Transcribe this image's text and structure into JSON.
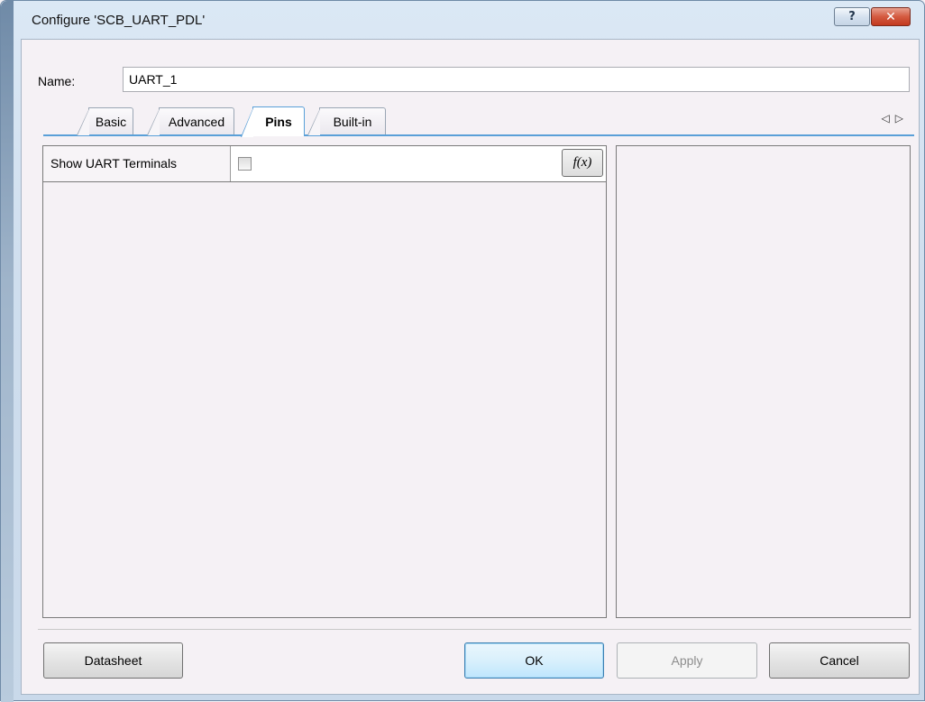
{
  "window": {
    "title": "Configure 'SCB_UART_PDL'",
    "help_icon": "?",
    "close_icon": "✕"
  },
  "name_field": {
    "label": "Name:",
    "value": "UART_1"
  },
  "tabs": [
    {
      "label": "Basic",
      "active": false
    },
    {
      "label": "Advanced",
      "active": false
    },
    {
      "label": "Pins",
      "active": true
    },
    {
      "label": "Built-in",
      "active": false
    }
  ],
  "tab_scroll": {
    "left_icon": "◁",
    "right_icon": "▷"
  },
  "properties": {
    "show_uart_terminals": {
      "label": "Show UART Terminals",
      "checked": false,
      "fx_label": "f(x)"
    }
  },
  "buttons": {
    "datasheet": "Datasheet",
    "ok": "OK",
    "apply": "Apply",
    "cancel": "Cancel"
  },
  "colors": {
    "tab_accent": "#5aa0d8",
    "ok_border": "#3c7fb1",
    "close_button": "#c23a1f"
  }
}
